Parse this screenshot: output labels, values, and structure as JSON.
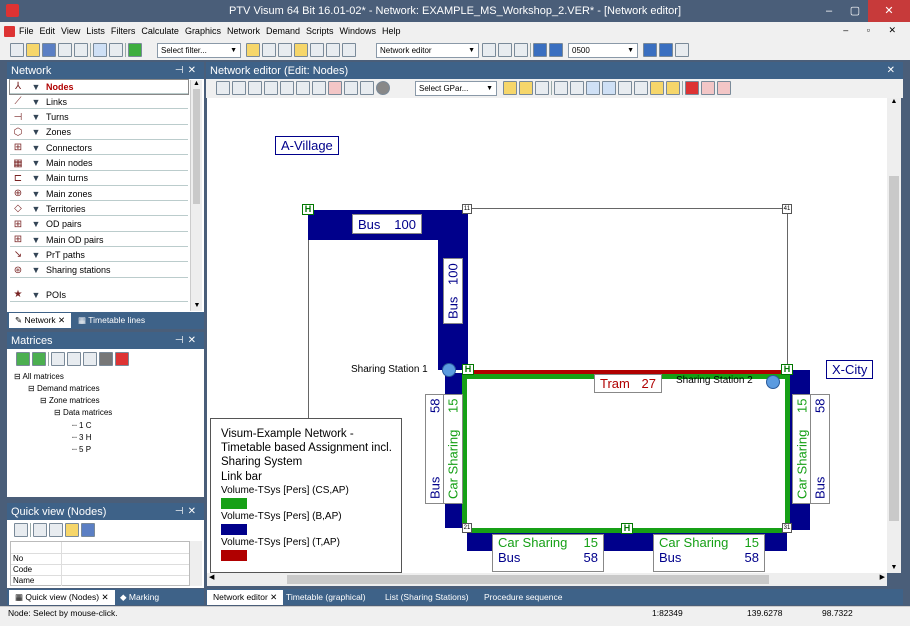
{
  "title": "PTV Visum 64 Bit 16.01-02* - Network: EXAMPLE_MS_Workshop_2.VER* - [Network editor]",
  "menu": [
    "File",
    "Edit",
    "View",
    "Lists",
    "Filters",
    "Calculate",
    "Graphics",
    "Network",
    "Demand",
    "Scripts",
    "Windows",
    "Help"
  ],
  "toolbar": {
    "filter_placeholder": "Select filter...",
    "mode": "Network editor",
    "time": "0500"
  },
  "network_panel": {
    "title": "Network",
    "items": [
      "Nodes",
      "Links",
      "Turns",
      "Zones",
      "Connectors",
      "Main nodes",
      "Main turns",
      "Main zones",
      "Territories",
      "OD pairs",
      "Main OD pairs",
      "PrT paths",
      "Sharing stations"
    ],
    "poi": "POIs",
    "tabs": [
      "Network",
      "Timetable lines"
    ]
  },
  "matrices_panel": {
    "title": "Matrices",
    "tree": [
      "All matrices",
      "Demand matrices",
      "Zone matrices",
      "Data matrices",
      "1 C",
      "3 H",
      "5 P"
    ]
  },
  "quickview": {
    "title": "Quick view (Nodes)",
    "rows": [
      "No",
      "Code",
      "Name"
    ],
    "tabs": [
      "Quick view (Nodes)",
      "Marking"
    ]
  },
  "editor": {
    "title": "Network editor (Edit: Nodes)",
    "gpar_placeholder": "Select GPar...",
    "labels": {
      "a_village": "A-Village",
      "x_city": "X-City",
      "bus_top": "Bus",
      "bus_top_val": "100",
      "bus_vert": "Bus",
      "bus_vert_val": "100",
      "tram": "Tram",
      "tram_val": "27",
      "station1": "Sharing Station 1",
      "station2": "Sharing Station 2",
      "left_58": "58",
      "left_cs": "Car Sharing",
      "left_15": "15",
      "left_bus": "Bus",
      "right_58": "58",
      "right_cs": "Car Sharing",
      "right_15": "15",
      "right_bus": "Bus",
      "b1_cs": "Car Sharing",
      "b1_15": "15",
      "b1_bus": "Bus",
      "b1_58": "58",
      "b2_cs": "Car Sharing",
      "b2_15": "15",
      "b2_bus": "Bus",
      "b2_58": "58"
    },
    "nodes": {
      "n11": "11",
      "n41": "41",
      "n21": "21",
      "n31": "31"
    },
    "hstop": "H",
    "legend": {
      "title": "Visum-Example Network - Timetable based Assignment incl. Sharing System",
      "subtitle": "Link bar",
      "items": [
        {
          "label": "Volume-TSys [Pers] (CS,AP)",
          "color": "#16a016"
        },
        {
          "label": "Volume-TSys [Pers] (B,AP)",
          "color": "#00008b"
        },
        {
          "label": "Volume-TSys [Pers] (T,AP)",
          "color": "#b00000"
        }
      ]
    },
    "tabs": [
      "Network editor",
      "Timetable (graphical)",
      "List (Sharing Stations)",
      "Procedure sequence"
    ]
  },
  "status": {
    "msg": "Node: Select by mouse-click.",
    "scale": "1:82349",
    "x": "139.6278",
    "y": "98.7322"
  },
  "colors": {
    "bus": "#00008b",
    "tram": "#b00000",
    "cs": "#16a016"
  }
}
